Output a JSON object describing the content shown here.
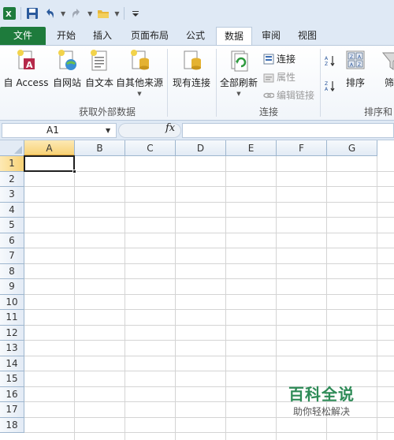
{
  "tabs": [
    {
      "label": "文件",
      "name": "tab-file"
    },
    {
      "label": "开始",
      "name": "tab-home"
    },
    {
      "label": "插入",
      "name": "tab-insert"
    },
    {
      "label": "页面布局",
      "name": "tab-page-layout"
    },
    {
      "label": "公式",
      "name": "tab-formulas"
    },
    {
      "label": "数据",
      "name": "tab-data"
    },
    {
      "label": "审阅",
      "name": "tab-review"
    },
    {
      "label": "视图",
      "name": "tab-view"
    }
  ],
  "active_tab": "数据",
  "ribbon": {
    "get_external_data": {
      "label": "获取外部数据",
      "from_access": "自 Access",
      "from_web": "自网站",
      "from_text": "自文本",
      "from_other": "自其他来源",
      "existing_connections": "现有连接"
    },
    "connections": {
      "label": "连接",
      "refresh_all": "全部刷新",
      "connections_btn": "连接",
      "properties": "属性",
      "edit_links": "编辑链接"
    },
    "sort_filter": {
      "label": "排序和",
      "sort": "排序",
      "filter": "筛"
    }
  },
  "formula_bar": {
    "name_box": "A1",
    "fx": "fx",
    "formula": ""
  },
  "columns": [
    "A",
    "B",
    "C",
    "D",
    "E",
    "F",
    "G"
  ],
  "rows": [
    "1",
    "2",
    "3",
    "4",
    "5",
    "6",
    "7",
    "8",
    "9",
    "10",
    "11",
    "12",
    "13",
    "14",
    "15",
    "16",
    "17",
    "18"
  ],
  "active_cell": "A1",
  "watermark": {
    "title": "百科全说",
    "subtitle": "助你轻松解决"
  },
  "colors": {
    "file_tab": "#1e7b3c",
    "accent_blue": "#dfe9f5",
    "selected_header": "#f8d276",
    "watermark_green": "#2e8b57"
  }
}
